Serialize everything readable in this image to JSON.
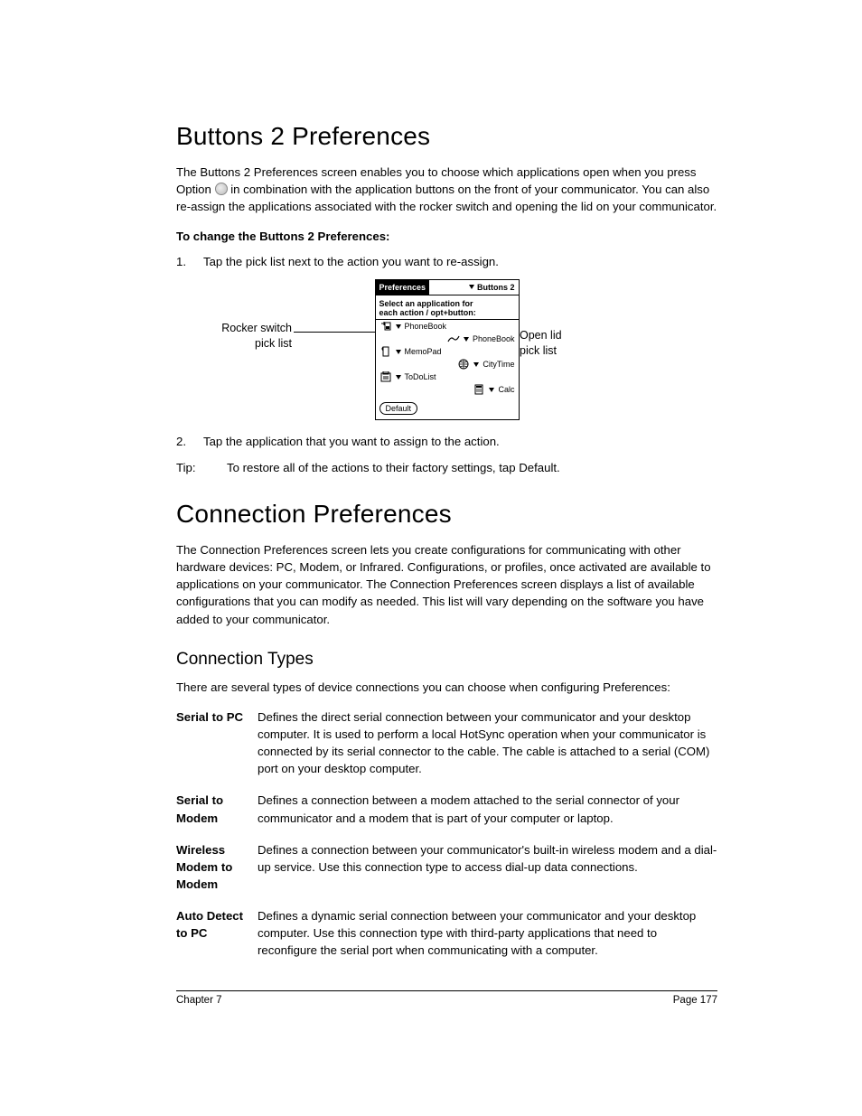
{
  "section1": {
    "title": "Buttons 2 Preferences",
    "intro_a": "The Buttons 2 Preferences screen enables you to choose which applications open when you press Option ",
    "intro_b": " in combination with the application buttons on the front of your communicator. You can also re-assign the applications associated with the rocker switch and opening the lid on your communicator.",
    "howto_heading": "To change the Buttons 2 Preferences:",
    "step1_num": "1.",
    "step1": "Tap the pick list next to the action you want to re-assign.",
    "step2_num": "2.",
    "step2": "Tap the application that you want to assign to the action.",
    "tip_label": "Tip:",
    "tip_text": "To restore all of the actions to their factory settings, tap Default.",
    "callout_left_l1": "Rocker switch",
    "callout_left_l2": "pick list",
    "callout_right_l1": "Open lid",
    "callout_right_l2": "pick list",
    "panel": {
      "title_tab": "Preferences",
      "dropdown": "Buttons 2",
      "subtitle_l1": "Select an application for",
      "subtitle_l2": "each action / opt+button:",
      "items": [
        "PhoneBook",
        "PhoneBook",
        "MemoPad",
        "CityTime",
        "ToDoList",
        "Calc"
      ],
      "default_btn": "Default"
    }
  },
  "section2": {
    "title": "Connection Preferences",
    "intro": "The Connection Preferences screen lets you create configurations for communicating with other hardware devices: PC, Modem, or Infrared. Configurations, or profiles, once activated are available to applications on your communicator. The Connection Preferences screen displays a list of available configurations that you can modify as needed. This list will vary depending on the software you have added to your communicator.",
    "subheading": "Connection Types",
    "subintro": "There are several types of device connections you can choose when configuring Preferences:",
    "types": [
      {
        "term": "Serial to PC",
        "def": "Defines the direct serial connection between your communicator and your desktop computer. It is used to perform a local HotSync operation when your communicator is connected by its serial connector to the cable. The cable is attached to a serial (COM) port on your desktop computer."
      },
      {
        "term": "Serial to Modem",
        "def": "Defines a connection between a modem attached to the serial connector of your communicator and a modem that is part of your computer or laptop."
      },
      {
        "term": "Wireless Modem to Modem",
        "def": "Defines a connection between your communicator's built-in wireless modem and a dial-up service. Use this connection type to access dial-up data connections."
      },
      {
        "term": "Auto Detect to PC",
        "def": "Defines a dynamic serial connection between your communicator and your desktop computer. Use this connection type with third-party applications that need to reconfigure the serial port when communicating with a computer."
      }
    ]
  },
  "footer": {
    "left": "Chapter 7",
    "right": "Page 177"
  }
}
